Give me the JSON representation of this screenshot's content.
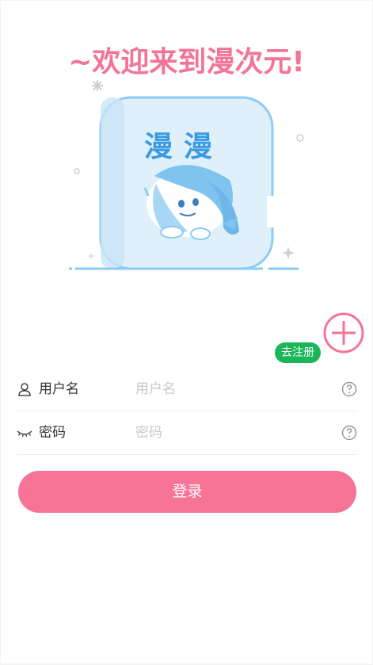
{
  "header": {
    "title": "~欢迎来到漫次元!"
  },
  "illustration": {
    "sign_text": "漫漫"
  },
  "actions": {
    "register_label": "去注册"
  },
  "form": {
    "username": {
      "label": "用户名",
      "placeholder": "用户名",
      "value": ""
    },
    "password": {
      "label": "密码",
      "placeholder": "密码",
      "value": ""
    }
  },
  "login": {
    "label": "登录"
  },
  "colors": {
    "accent": "#f77496",
    "title": "#f47498",
    "register": "#1bb65a"
  },
  "icons": {
    "add": "plus-circle-icon",
    "user": "user-icon",
    "password": "closed-eye-icon",
    "help": "question-circle-icon"
  }
}
